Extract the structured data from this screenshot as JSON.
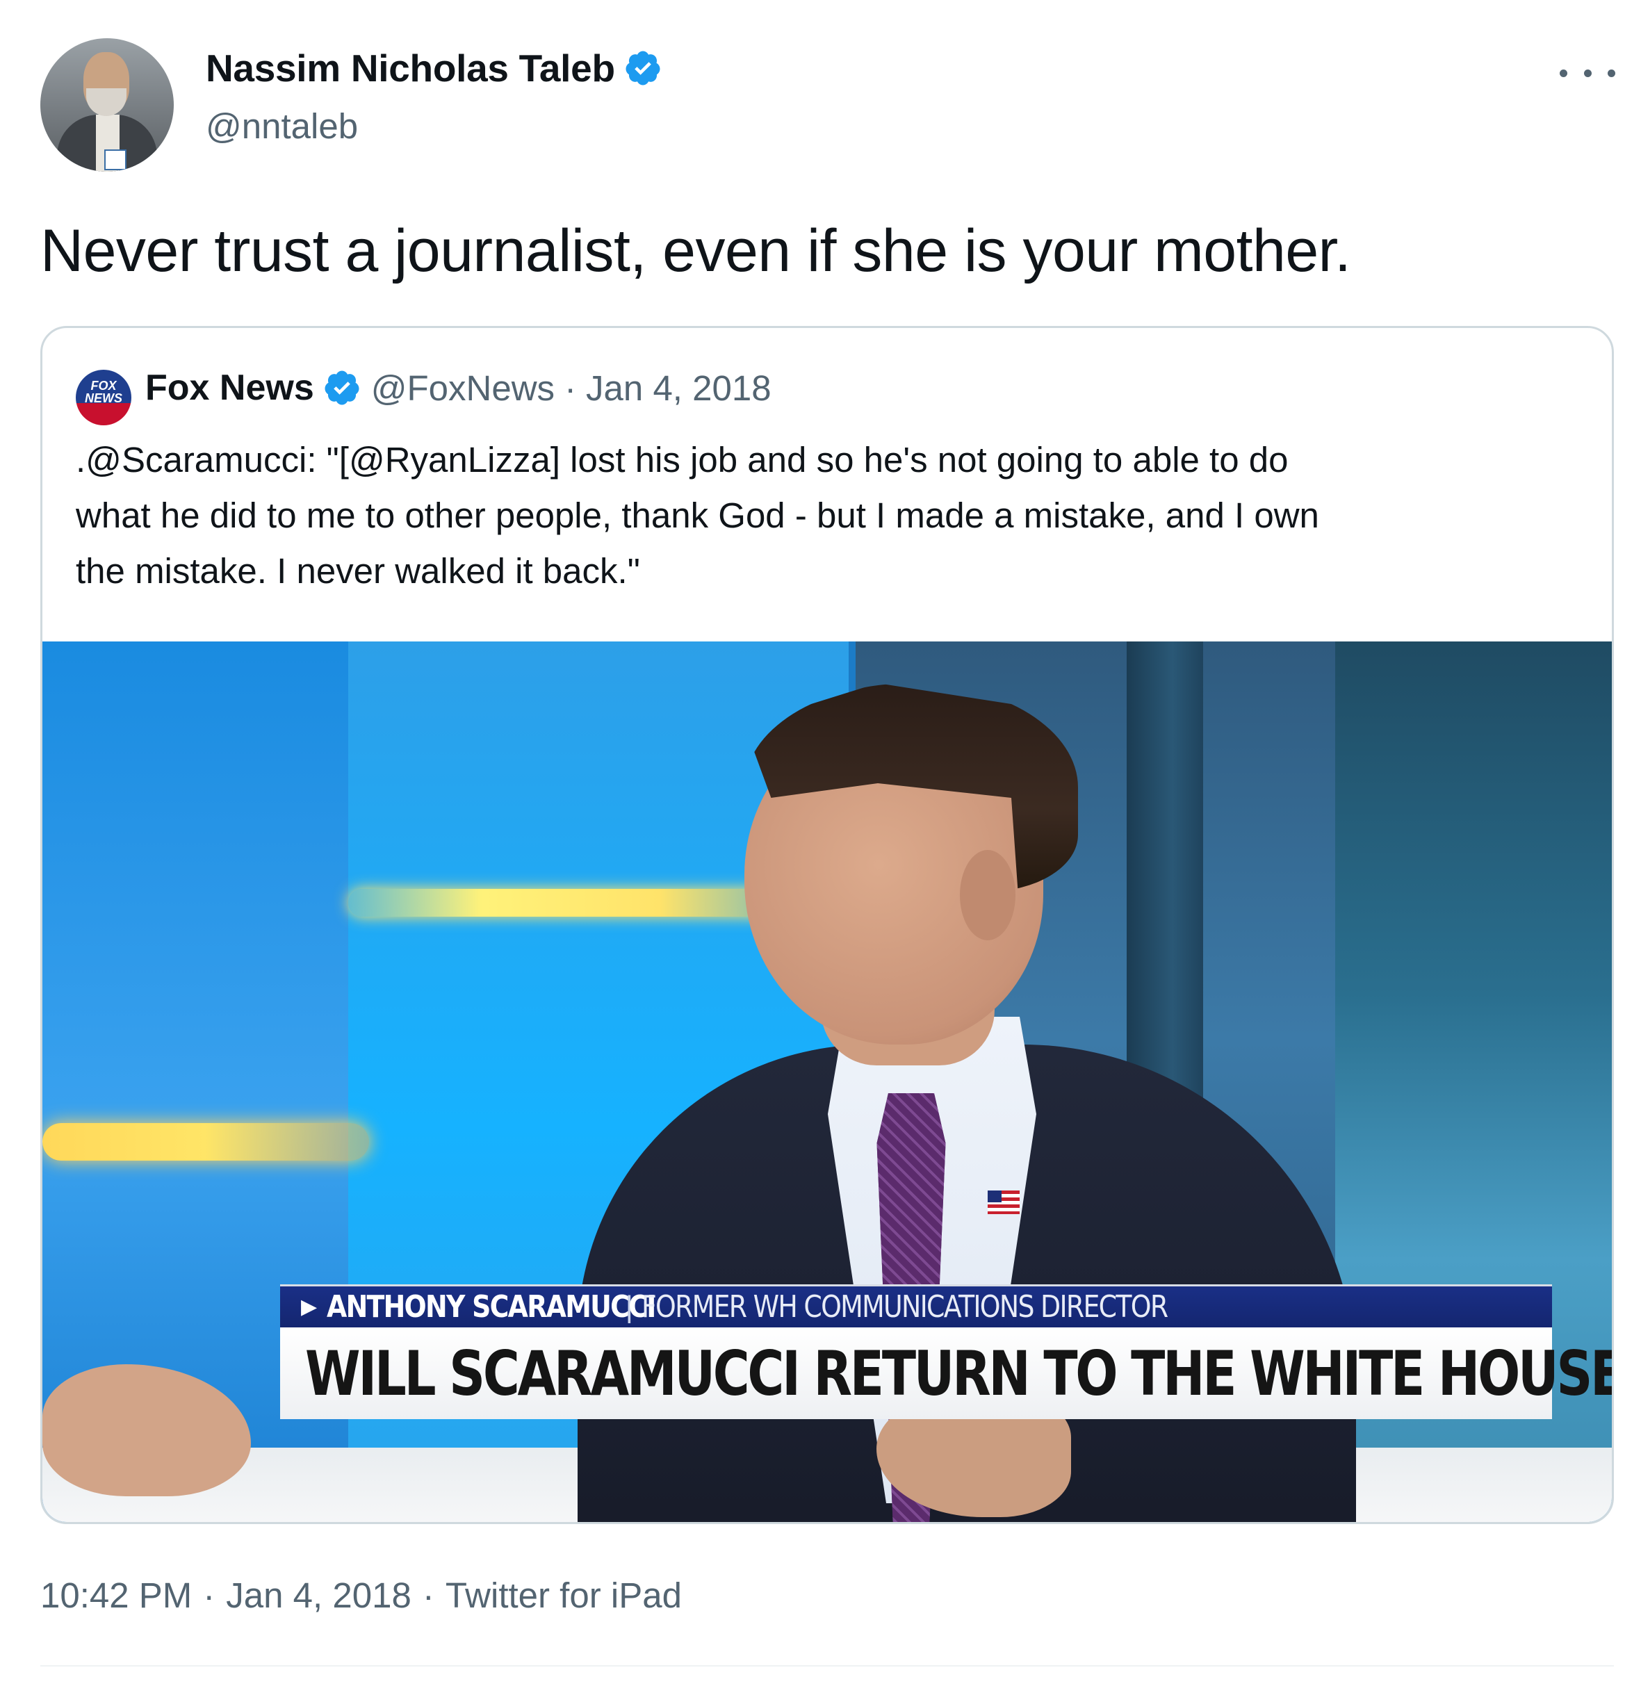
{
  "author": {
    "name": "Nassim Nicholas Taleb",
    "handle": "@nntaleb",
    "verified": true,
    "avatar_icon": "profile-photo"
  },
  "more_icon": "ellipsis-icon",
  "tweet_text": "Never trust a journalist, even if she is your mother.",
  "quoted_tweet": {
    "author_name": "Fox News",
    "handle": "@FoxNews",
    "separator": "·",
    "date": "Jan 4, 2018",
    "verified": true,
    "avatar_text": "FOX NEWS",
    "text_lines": [
      ".@Scaramucci: \"[@RyanLizza] lost his job and so he's not going to able to do",
      "what he did to me to other people, thank God - but I made a mistake, and I own",
      "the mistake. I never walked it back.\""
    ],
    "media": {
      "lower_third_name": "ANTHONY SCARAMUCCI",
      "lower_third_divider": "|",
      "lower_third_title": "FORMER WH COMMUNICATIONS DIRECTOR",
      "headline": "WILL SCARAMUCCI RETURN TO THE WHITE HOUSE?"
    }
  },
  "meta": {
    "time": "10:42 PM",
    "separator": "·",
    "date": "Jan 4, 2018",
    "source": "Twitter for iPad"
  },
  "colors": {
    "verified_blue": "#1d9bf0",
    "secondary_text": "#536471",
    "border": "#cfd9de"
  }
}
